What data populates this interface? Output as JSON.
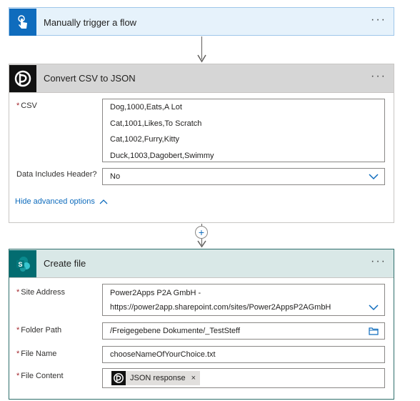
{
  "trigger": {
    "title": "Manually trigger a flow",
    "more": "···"
  },
  "convert": {
    "title": "Convert CSV to JSON",
    "more": "···",
    "csv_label": "CSV",
    "csv_lines": [
      "Dog,1000,Eats,A Lot",
      "Cat,1001,Likes,To Scratch",
      "Cat,1002,Furry,Kitty",
      "Duck,1003,Dagobert,Swimmy"
    ],
    "header_label": "Data Includes Header?",
    "header_value": "No",
    "advanced_link": "Hide advanced options"
  },
  "create": {
    "title": "Create file",
    "more": "···",
    "site_label": "Site Address",
    "site_line1": "Power2Apps P2A GmbH -",
    "site_line2": "https://power2app.sharepoint.com/sites/Power2AppsP2AGmbH",
    "folder_label": "Folder Path",
    "folder_value": "/Freigegebene Dokumente/_TestSteff",
    "name_label": "File Name",
    "name_value": "chooseNameOfYourChoice.txt",
    "content_label": "File Content",
    "token_label": "JSON response",
    "token_remove": "×"
  },
  "required_mark": "*",
  "add_step": "+",
  "colors": {
    "accent": "#0f6cbd",
    "required": "#a4262c",
    "sharepoint": "#036c70"
  }
}
